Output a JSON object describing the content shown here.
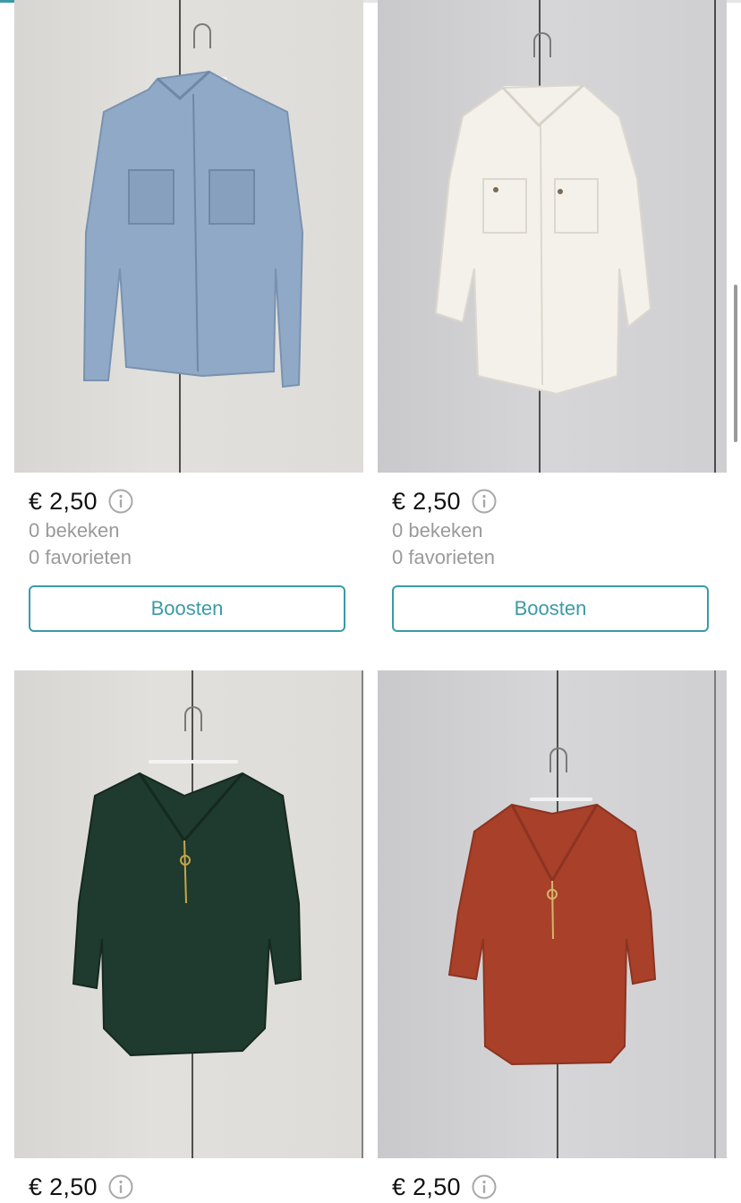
{
  "listings": [
    {
      "item": "denim-shirt",
      "price": "€ 2,50",
      "views": "0 bekeken",
      "favorites": "0 favorieten",
      "boost_label": "Boosten",
      "color": "#8fa9c6"
    },
    {
      "item": "white-blouse",
      "price": "€ 2,50",
      "views": "0 bekeken",
      "favorites": "0 favorieten",
      "boost_label": "Boosten",
      "color": "#f4f1ea"
    },
    {
      "item": "green-blouse",
      "price": "€ 2,50",
      "color": "#1f3a2e"
    },
    {
      "item": "rust-blouse",
      "price": "€ 2,50",
      "color": "#a8402a"
    }
  ],
  "theme": {
    "accent": "#3a9aa8",
    "muted_text": "#9a9a9a"
  },
  "icons": {
    "info": "info-circle-icon"
  }
}
